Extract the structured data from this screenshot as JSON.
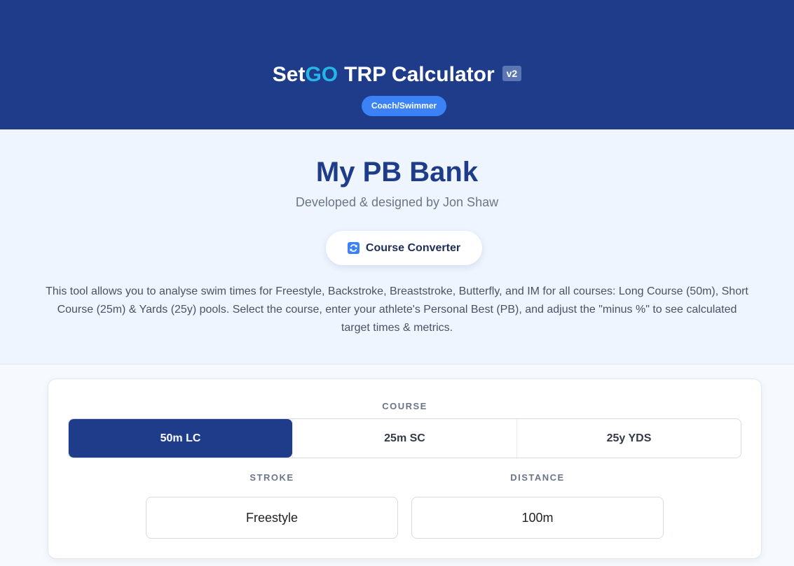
{
  "header": {
    "brand_set": "Set",
    "brand_go": "GO",
    "brand_rest": "TRP Calculator",
    "version": "v2",
    "role": "Coach/Swimmer"
  },
  "hero": {
    "title": "My PB Bank",
    "subtitle": "Developed & designed by Jon Shaw",
    "converter_label": "Course Converter",
    "converter_icon": "refresh-icon",
    "description": "This tool allows you to analyse swim times for Freestyle, Backstroke, Breaststroke, Butterfly, and IM for all courses: Long Course (50m), Short Course (25m) & Yards (25y) pools. Select the course, enter your athlete's Personal Best (PB), and adjust the \"minus %\" to see calculated target times & metrics."
  },
  "form": {
    "course_label": "COURSE",
    "courses": [
      {
        "label": "50m LC",
        "active": true
      },
      {
        "label": "25m SC",
        "active": false
      },
      {
        "label": "25y YDS",
        "active": false
      }
    ],
    "stroke_label": "STROKE",
    "stroke_value": "Freestyle",
    "distance_label": "DISTANCE",
    "distance_value": "100m"
  },
  "colors": {
    "primary": "#1e3c8a",
    "accent": "#25b6e8",
    "pill": "#3a82f6"
  }
}
